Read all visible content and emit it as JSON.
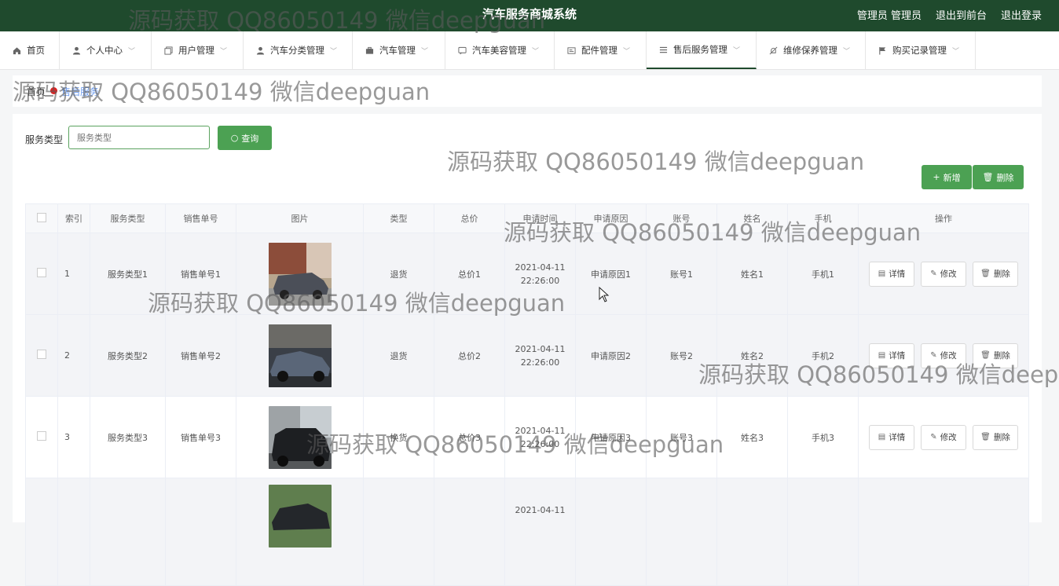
{
  "header": {
    "title": "汽车服务商城系统",
    "admin": "管理员 管理员",
    "back": "退出到前台",
    "logout": "退出登录"
  },
  "nav": [
    {
      "label": "首页",
      "icon": "home-icon"
    },
    {
      "label": "个人中心",
      "icon": "user-icon"
    },
    {
      "label": "用户管理",
      "icon": "copy-icon"
    },
    {
      "label": "汽车分类管理",
      "icon": "user-icon"
    },
    {
      "label": "汽车管理",
      "icon": "briefcase-icon"
    },
    {
      "label": "汽车美容管理",
      "icon": "chat-icon"
    },
    {
      "label": "配件管理",
      "icon": "card-icon"
    },
    {
      "label": "售后服务管理",
      "icon": "menu-icon"
    },
    {
      "label": "维修保养管理",
      "icon": "bell-off-icon"
    },
    {
      "label": "购买记录管理",
      "icon": "flag-icon"
    }
  ],
  "breadcrumb": {
    "home": "首页",
    "current": "售后服务"
  },
  "search": {
    "label": "服务类型",
    "placeholder": "服务类型",
    "button": "查询"
  },
  "actions": {
    "add": "新增",
    "delete": "删除"
  },
  "table": {
    "headers": [
      "",
      "索引",
      "服务类型",
      "销售单号",
      "图片",
      "类型",
      "总价",
      "申请时间",
      "申请原因",
      "账号",
      "姓名",
      "手机",
      "操作"
    ],
    "rows": [
      {
        "index": "1",
        "service_type": "服务类型1",
        "order_no": "销售单号1",
        "type": "退货",
        "total": "总价1",
        "date": "2021-04-11",
        "time": "22:26:00",
        "reason": "申请原因1",
        "account": "账号1",
        "name": "姓名1",
        "phone": "手机1"
      },
      {
        "index": "2",
        "service_type": "服务类型2",
        "order_no": "销售单号2",
        "type": "退货",
        "total": "总价2",
        "date": "2021-04-11",
        "time": "22:26:00",
        "reason": "申请原因2",
        "account": "账号2",
        "name": "姓名2",
        "phone": "手机2"
      },
      {
        "index": "3",
        "service_type": "服务类型3",
        "order_no": "销售单号3",
        "type": "换货",
        "total": "总价3",
        "date": "2021-04-11",
        "time": "22:26:00",
        "reason": "申请原因3",
        "account": "账号3",
        "name": "姓名3",
        "phone": "手机3"
      },
      {
        "date": "2021-04-11"
      }
    ],
    "ops": {
      "detail": "详情",
      "edit": "修改",
      "delete": "删除"
    }
  },
  "watermark": "源码获取 QQ86050149 微信deepguan",
  "colors": {
    "header_bg": "#1f4a2d",
    "accent": "#4ca153"
  }
}
